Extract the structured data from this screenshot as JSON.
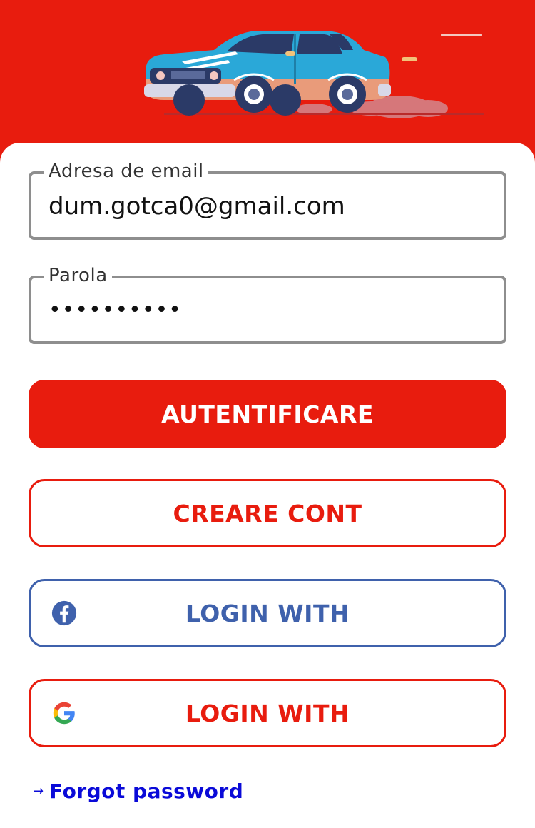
{
  "colors": {
    "brand_red": "#E81C0E",
    "facebook_blue": "#3F61AC",
    "link_blue": "#0A0AD8",
    "field_border": "#8E8E8E"
  },
  "header": {
    "illustration": "car-illustration"
  },
  "form": {
    "email": {
      "label": "Adresa de email",
      "value": "dum.gotca0@gmail.com"
    },
    "password": {
      "label": "Parola",
      "value": "••••••••••"
    }
  },
  "buttons": {
    "login": "AUTENTIFICARE",
    "create_account": "CREARE CONT",
    "facebook": {
      "label": "LOGIN WITH",
      "icon": "facebook-icon"
    },
    "google": {
      "label": "LOGIN WITH",
      "icon": "google-icon"
    }
  },
  "links": {
    "forgot_password": "Forgot password",
    "forgot_arrow": "→"
  }
}
